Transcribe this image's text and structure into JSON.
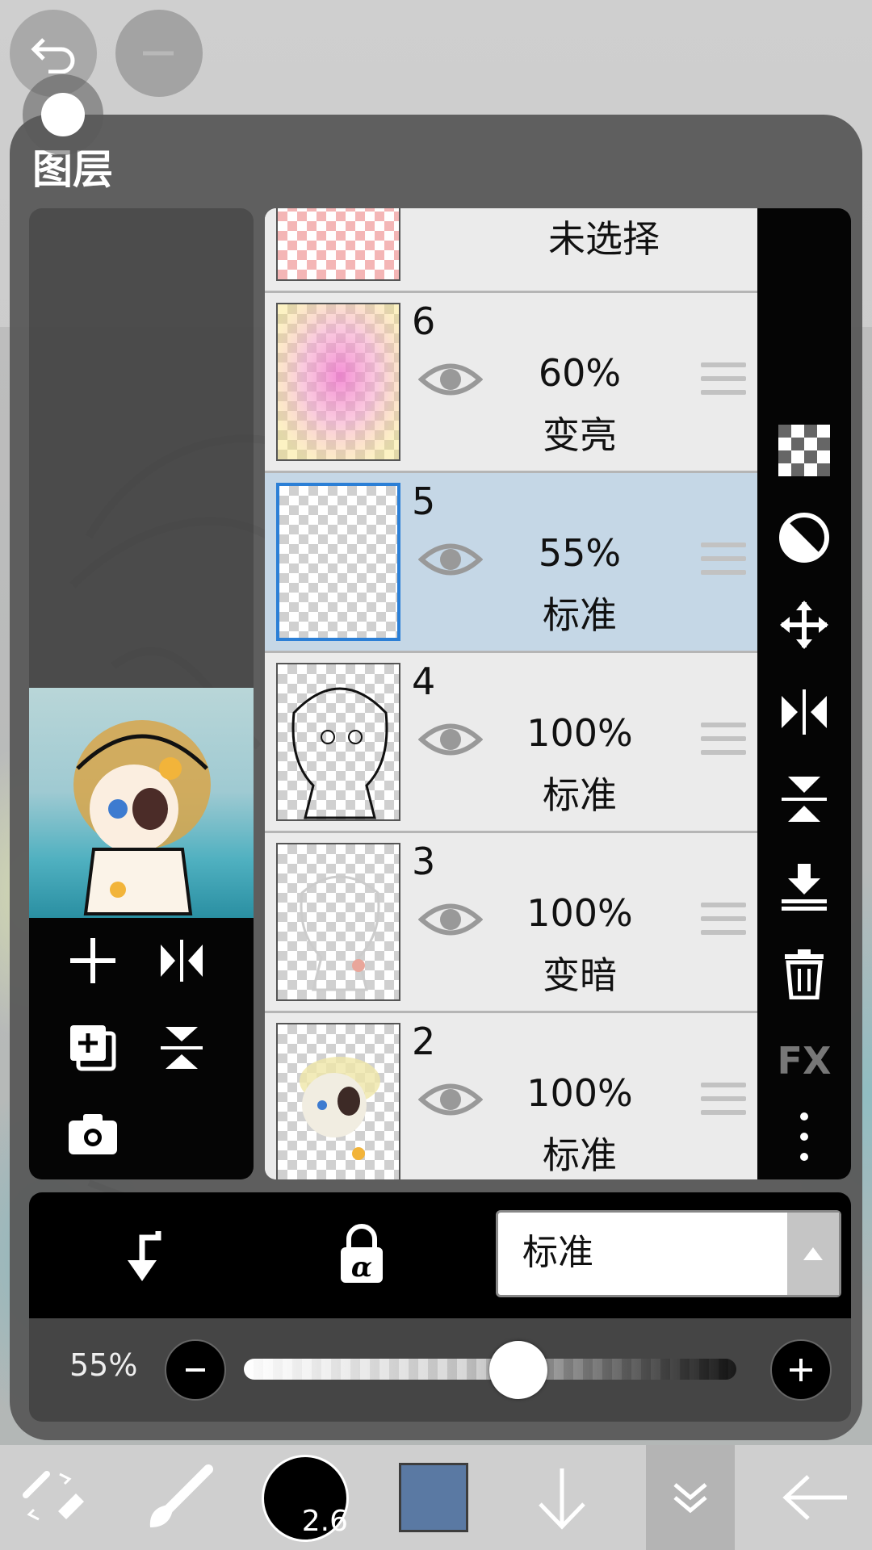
{
  "panel": {
    "title": "图层"
  },
  "layers": [
    {
      "num": "",
      "label": "未选择"
    },
    {
      "num": "6",
      "opacity": "60%",
      "mode": "变亮"
    },
    {
      "num": "5",
      "opacity": "55%",
      "mode": "标准",
      "selected": true
    },
    {
      "num": "4",
      "opacity": "100%",
      "mode": "标准"
    },
    {
      "num": "3",
      "opacity": "100%",
      "mode": "变暗"
    },
    {
      "num": "2",
      "opacity": "100%",
      "mode": "标准"
    }
  ],
  "right_tools": [
    "transparency-icon",
    "invert-icon",
    "move-icon",
    "flip-horizontal-icon",
    "flip-vertical-icon",
    "merge-down-icon",
    "trash-icon",
    "fx-icon",
    "more-icon"
  ],
  "fx_label": "FX",
  "blend": {
    "mode": "标准"
  },
  "opacity_bar": {
    "label": "55%",
    "value": 0.55
  },
  "toolbar": {
    "brush_size": "2.6",
    "color": "#5a79a3"
  }
}
